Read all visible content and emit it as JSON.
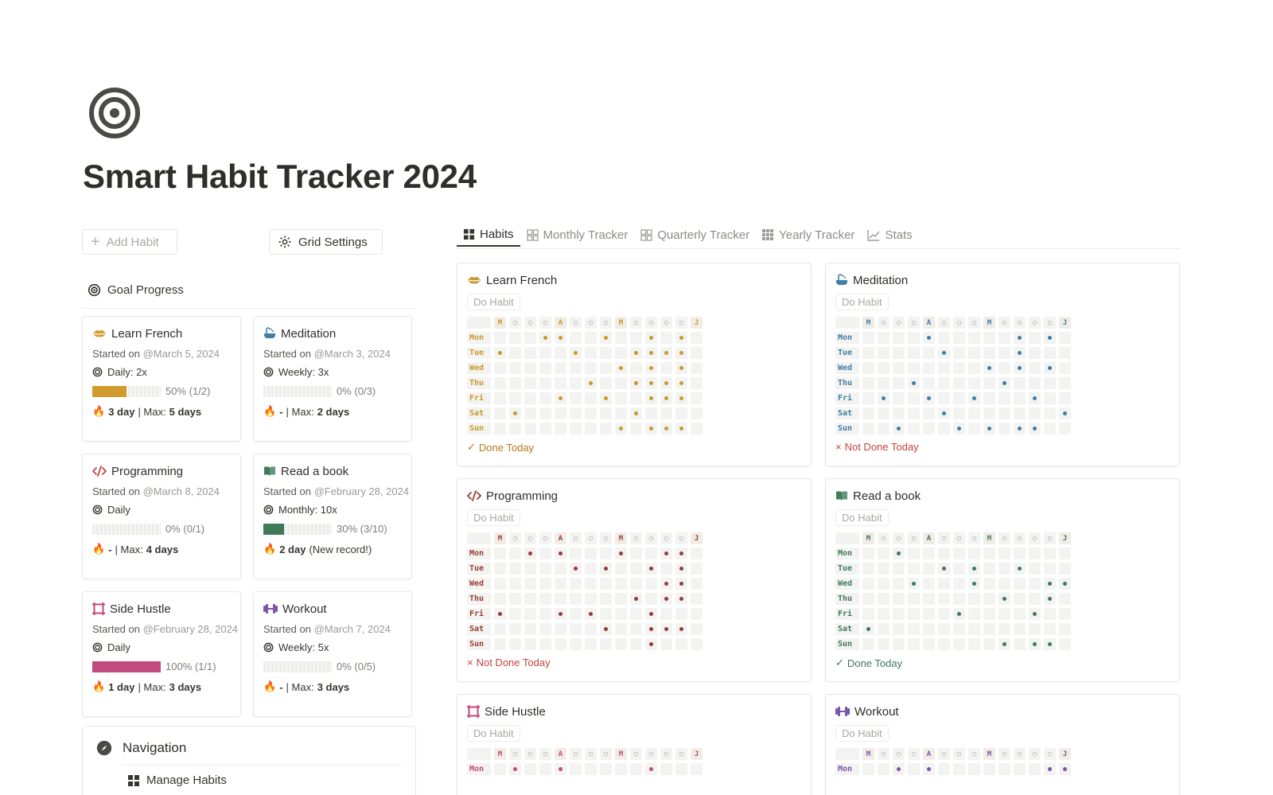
{
  "page": {
    "title": "Smart Habit Tracker 2024",
    "icon": "target-icon"
  },
  "toolbar": {
    "add_habit": "Add Habit",
    "grid_settings": "Grid Settings"
  },
  "goal_progress": {
    "header": "Goal Progress",
    "cards": [
      {
        "name": "Learn French",
        "icon": "lips-icon",
        "started_prefix": "Started on ",
        "started": "@March 5, 2024",
        "target": "Daily: 2x",
        "progress": 0.5,
        "progress_label": "50% (1/2)",
        "color": "#d29b2f",
        "streak_a": "3 day",
        "streak_sep": " | Max: ",
        "streak_b": "5 days"
      },
      {
        "name": "Meditation",
        "icon": "bathtub-icon",
        "started_prefix": "Started on ",
        "started": "@March 3, 2024",
        "target": "Weekly: 3x",
        "progress": 0,
        "progress_label": "0% (0/3)",
        "color": "#3f7ea6",
        "streak_a": "-",
        "streak_sep": " | Max: ",
        "streak_b": "2 days"
      },
      {
        "name": "Programming",
        "icon": "code-icon",
        "started_prefix": "Started on ",
        "started": "@March 8, 2024",
        "target": "Daily",
        "progress": 0,
        "progress_label": "0% (0/1)",
        "color": "#c4453f",
        "streak_a": "-",
        "streak_sep": " | Max: ",
        "streak_b": "4 days"
      },
      {
        "name": "Read a book",
        "icon": "book-icon",
        "started_prefix": "Started on ",
        "started": "@February 28, 2024",
        "target": "Monthly: 10x",
        "progress": 0.3,
        "progress_label": "30% (3/10)",
        "color": "#3e7b59",
        "streak_a": "2 day",
        "streak_sep": " (New record!)",
        "streak_b": ""
      },
      {
        "name": "Side Hustle",
        "icon": "frame-icon",
        "started_prefix": "Started on ",
        "started": "@February 28, 2024",
        "target": "Daily",
        "progress": 1.0,
        "progress_label": "100% (1/1)",
        "color": "#c24a7d",
        "streak_a": "1 day",
        "streak_sep": " | Max: ",
        "streak_b": "3 days"
      },
      {
        "name": "Workout",
        "icon": "dumbbell-icon",
        "started_prefix": "Started on ",
        "started": "@March 7, 2024",
        "target": "Weekly: 5x",
        "progress": 0,
        "progress_label": "0% (0/5)",
        "color": "#7a55a8",
        "streak_a": "-",
        "streak_sep": " | Max: ",
        "streak_b": "3 days"
      }
    ]
  },
  "navigation": {
    "title": "Navigation",
    "items": [
      "Manage Habits"
    ]
  },
  "tabs": [
    {
      "label": "Habits",
      "icon": "grid-icon",
      "active": true
    },
    {
      "label": "Monthly Tracker",
      "icon": "gallery-icon",
      "active": false
    },
    {
      "label": "Quarterly Tracker",
      "icon": "gallery-icon",
      "active": false
    },
    {
      "label": "Yearly Tracker",
      "icon": "grid9-icon",
      "active": false
    },
    {
      "label": "Stats",
      "icon": "chart-icon",
      "active": false
    }
  ],
  "habit_grid": {
    "do_habit": "Do Habit",
    "header_row": [
      "M",
      "○",
      "○",
      "○",
      "A",
      "○",
      "○",
      "○",
      "M",
      "○",
      "○",
      "○",
      "○",
      "J"
    ],
    "days": [
      "Mon",
      "Tue",
      "Wed",
      "Thu",
      "Fri",
      "Sat",
      "Sun"
    ],
    "cards": [
      {
        "name": "Learn French",
        "icon": "lips-icon",
        "color": "#c99a2e",
        "status": "Done Today",
        "done": true,
        "marks": [
          [
            3,
            4,
            7,
            10,
            12
          ],
          [
            0,
            5,
            9,
            10,
            11,
            12
          ],
          [
            8,
            10,
            12
          ],
          [
            6,
            9,
            10,
            11,
            12
          ],
          [
            4,
            7,
            10,
            11,
            12
          ],
          [
            1,
            9
          ],
          [
            8,
            10,
            11,
            12
          ]
        ]
      },
      {
        "name": "Meditation",
        "icon": "bathtub-icon",
        "color": "#3f7ea6",
        "status": "Not Done Today",
        "done": false,
        "marks": [
          [
            4,
            10,
            12
          ],
          [
            5,
            10
          ],
          [
            8,
            10,
            12
          ],
          [
            3,
            9
          ],
          [
            1,
            4,
            7,
            11
          ],
          [
            5,
            13
          ],
          [
            2,
            6,
            8,
            10,
            11
          ]
        ]
      },
      {
        "name": "Programming",
        "icon": "code-icon",
        "color": "#9a3b34",
        "status": "Not Done Today",
        "done": false,
        "marks": [
          [
            2,
            4,
            8,
            11,
            12
          ],
          [
            5,
            7,
            10,
            12
          ],
          [
            11,
            12
          ],
          [
            9,
            11,
            12
          ],
          [
            0,
            4,
            6,
            10
          ],
          [
            7,
            10,
            11,
            12
          ],
          [
            10
          ]
        ]
      },
      {
        "name": "Read a book",
        "icon": "book-icon",
        "color": "#3e7b59",
        "status": "Done Today",
        "done": true,
        "marks": [
          [
            2
          ],
          [
            5,
            7,
            10
          ],
          [
            3,
            7,
            12,
            13
          ],
          [
            9,
            12
          ],
          [
            6,
            11
          ],
          [
            0
          ],
          [
            9,
            11,
            12
          ]
        ]
      },
      {
        "name": "Side Hustle",
        "icon": "frame-icon",
        "color": "#c24a7d",
        "status": "",
        "done": false,
        "marks": [
          [
            1,
            4,
            10
          ]
        ]
      },
      {
        "name": "Workout",
        "icon": "dumbbell-icon",
        "color": "#7a55a8",
        "status": "",
        "done": false,
        "marks": [
          [
            2,
            4,
            12,
            13
          ]
        ]
      }
    ]
  }
}
